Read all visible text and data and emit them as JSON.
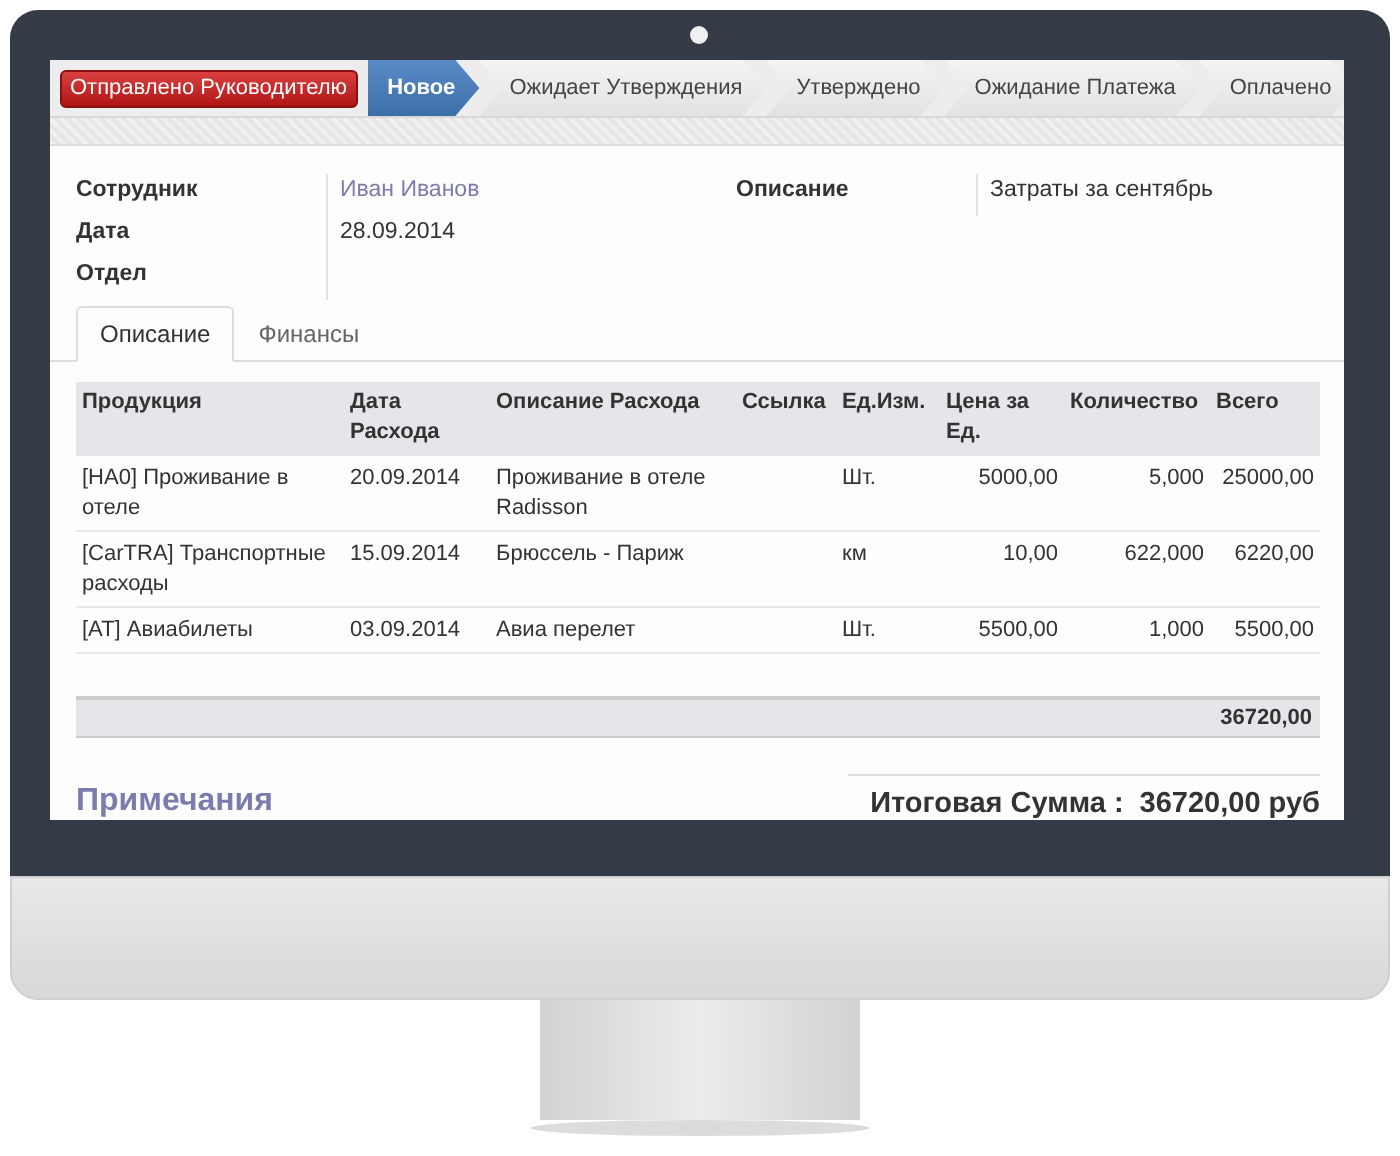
{
  "status_button": "Отправлено Руководителю",
  "stages": [
    {
      "label": "Новое",
      "selected": true
    },
    {
      "label": "Ожидает Утверждения",
      "selected": false
    },
    {
      "label": "Утверждено",
      "selected": false
    },
    {
      "label": "Ожидание Платежа",
      "selected": false
    },
    {
      "label": "Оплачено",
      "selected": false
    }
  ],
  "fields_left": [
    {
      "label": "Сотрудник",
      "value": "Иван Иванов",
      "kind": "link"
    },
    {
      "label": "Дата",
      "value": "28.09.2014"
    },
    {
      "label": "Отдел"
    }
  ],
  "fields_right": [
    {
      "label": "Описание",
      "value": "Затраты за сентябрь"
    }
  ],
  "tabs": [
    {
      "label": "Описание",
      "selected": true
    },
    {
      "label": "Финансы",
      "selected": false
    }
  ],
  "table": {
    "columns": [
      "Продукция",
      "Дата Расхода",
      "Описание Расхода",
      "Ссылка",
      "Ед.Изм.",
      "Цена за Ед.",
      "Количество",
      "Всего"
    ],
    "rows": [
      [
        "[HA0] Проживание в отеле",
        "20.09.2014",
        "Проживание в отеле Radisson",
        "",
        "Шт.",
        "5000,00",
        "5,000",
        "25000,00"
      ],
      [
        "[CarTRA] Транспортные расходы",
        "15.09.2014",
        "Брюссель - Париж",
        "",
        "км",
        "10,00",
        "622,000",
        "6220,00"
      ],
      [
        "[AT] Авиабилеты",
        "03.09.2014",
        "Авиа перелет",
        "",
        "Шт.",
        "5500,00",
        "1,000",
        "5500,00"
      ]
    ],
    "total": "36720,00"
  },
  "notes_title": "Примечания",
  "grand_total": {
    "label": "Итоговая Сумма :",
    "value": "36720,00 руб"
  }
}
